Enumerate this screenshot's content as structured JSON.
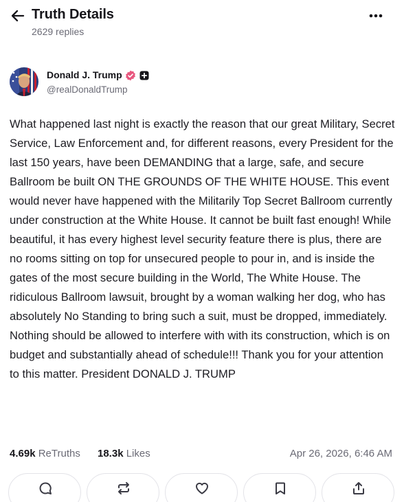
{
  "header": {
    "title": "Truth Details",
    "replies": "2629 replies",
    "back_icon": "arrow-left-icon",
    "more_icon": "more-horizontal-icon"
  },
  "author": {
    "display_name": "Donald J. Trump",
    "handle": "@realDonaldTrump",
    "verified_icon": "verified-badge-icon",
    "verified_color": "#e8577e",
    "plus_icon": "plus-badge-icon"
  },
  "post": {
    "text": "What happened last night is exactly the reason that our great Military, Secret Service, Law Enforcement and, for different reasons, every President for the last 150 years, have been DEMANDING that a large, safe, and secure Ballroom be built ON THE GROUNDS OF THE WHITE HOUSE. This event would never have happened with the Militarily Top Secret Ballroom currently under construction at the White House. It cannot be built fast enough! While beautiful, it has every highest level security feature there is plus, there are no rooms sitting on top for unsecured people to pour in, and is inside the gates of the most secure building in the World, The White House. The ridiculous Ballroom lawsuit, brought by a woman walking her dog, who has absolutely No Standing to bring such a suit, must be dropped, immediately. Nothing should be allowed to interfere with with its construction, which is on budget and substantially ahead of schedule!!! Thank you for your attention to this matter. President DONALD J. TRUMP"
  },
  "stats": {
    "retruths_count": "4.69k",
    "retruths_label": "ReTruths",
    "likes_count": "18.3k",
    "likes_label": "Likes",
    "timestamp": "Apr 26, 2026, 6:46 AM"
  },
  "actions": [
    {
      "icon": "reply-icon"
    },
    {
      "icon": "retruth-icon"
    },
    {
      "icon": "heart-icon"
    },
    {
      "icon": "bookmark-icon"
    },
    {
      "icon": "share-icon"
    }
  ]
}
